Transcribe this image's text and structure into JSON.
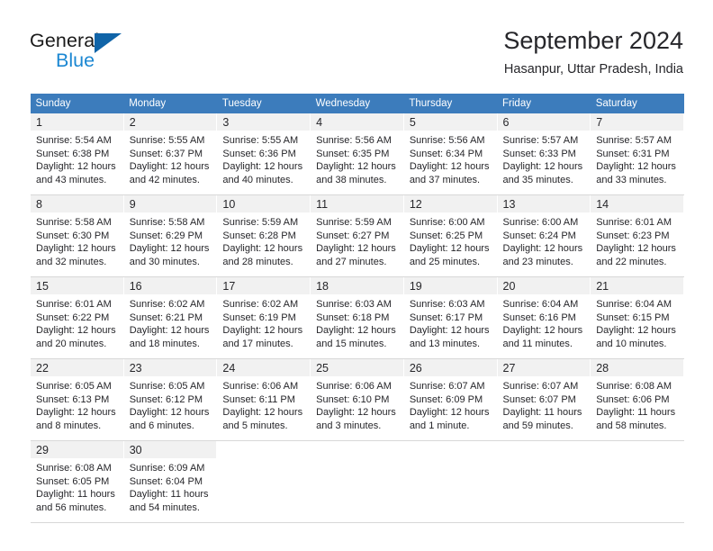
{
  "brand": {
    "word1": "General",
    "word2": "Blue",
    "triangle_color": "#1064a8",
    "blue_color": "#1b87d2"
  },
  "header": {
    "title": "September 2024",
    "subtitle": "Hasanpur, Uttar Pradesh, India"
  },
  "theme": {
    "header_row_bg": "#3c7cbc",
    "header_row_text": "#ffffff",
    "daynum_band_bg": "#f1f1f1",
    "grid_rule": "#d8d8d8",
    "text": "#26262a"
  },
  "weekday_headers": [
    "Sunday",
    "Monday",
    "Tuesday",
    "Wednesday",
    "Thursday",
    "Friday",
    "Saturday"
  ],
  "weeks": [
    [
      {
        "day": "1",
        "sunrise": "Sunrise: 5:54 AM",
        "sunset": "Sunset: 6:38 PM",
        "daylight1": "Daylight: 12 hours",
        "daylight2": "and 43 minutes."
      },
      {
        "day": "2",
        "sunrise": "Sunrise: 5:55 AM",
        "sunset": "Sunset: 6:37 PM",
        "daylight1": "Daylight: 12 hours",
        "daylight2": "and 42 minutes."
      },
      {
        "day": "3",
        "sunrise": "Sunrise: 5:55 AM",
        "sunset": "Sunset: 6:36 PM",
        "daylight1": "Daylight: 12 hours",
        "daylight2": "and 40 minutes."
      },
      {
        "day": "4",
        "sunrise": "Sunrise: 5:56 AM",
        "sunset": "Sunset: 6:35 PM",
        "daylight1": "Daylight: 12 hours",
        "daylight2": "and 38 minutes."
      },
      {
        "day": "5",
        "sunrise": "Sunrise: 5:56 AM",
        "sunset": "Sunset: 6:34 PM",
        "daylight1": "Daylight: 12 hours",
        "daylight2": "and 37 minutes."
      },
      {
        "day": "6",
        "sunrise": "Sunrise: 5:57 AM",
        "sunset": "Sunset: 6:33 PM",
        "daylight1": "Daylight: 12 hours",
        "daylight2": "and 35 minutes."
      },
      {
        "day": "7",
        "sunrise": "Sunrise: 5:57 AM",
        "sunset": "Sunset: 6:31 PM",
        "daylight1": "Daylight: 12 hours",
        "daylight2": "and 33 minutes."
      }
    ],
    [
      {
        "day": "8",
        "sunrise": "Sunrise: 5:58 AM",
        "sunset": "Sunset: 6:30 PM",
        "daylight1": "Daylight: 12 hours",
        "daylight2": "and 32 minutes."
      },
      {
        "day": "9",
        "sunrise": "Sunrise: 5:58 AM",
        "sunset": "Sunset: 6:29 PM",
        "daylight1": "Daylight: 12 hours",
        "daylight2": "and 30 minutes."
      },
      {
        "day": "10",
        "sunrise": "Sunrise: 5:59 AM",
        "sunset": "Sunset: 6:28 PM",
        "daylight1": "Daylight: 12 hours",
        "daylight2": "and 28 minutes."
      },
      {
        "day": "11",
        "sunrise": "Sunrise: 5:59 AM",
        "sunset": "Sunset: 6:27 PM",
        "daylight1": "Daylight: 12 hours",
        "daylight2": "and 27 minutes."
      },
      {
        "day": "12",
        "sunrise": "Sunrise: 6:00 AM",
        "sunset": "Sunset: 6:25 PM",
        "daylight1": "Daylight: 12 hours",
        "daylight2": "and 25 minutes."
      },
      {
        "day": "13",
        "sunrise": "Sunrise: 6:00 AM",
        "sunset": "Sunset: 6:24 PM",
        "daylight1": "Daylight: 12 hours",
        "daylight2": "and 23 minutes."
      },
      {
        "day": "14",
        "sunrise": "Sunrise: 6:01 AM",
        "sunset": "Sunset: 6:23 PM",
        "daylight1": "Daylight: 12 hours",
        "daylight2": "and 22 minutes."
      }
    ],
    [
      {
        "day": "15",
        "sunrise": "Sunrise: 6:01 AM",
        "sunset": "Sunset: 6:22 PM",
        "daylight1": "Daylight: 12 hours",
        "daylight2": "and 20 minutes."
      },
      {
        "day": "16",
        "sunrise": "Sunrise: 6:02 AM",
        "sunset": "Sunset: 6:21 PM",
        "daylight1": "Daylight: 12 hours",
        "daylight2": "and 18 minutes."
      },
      {
        "day": "17",
        "sunrise": "Sunrise: 6:02 AM",
        "sunset": "Sunset: 6:19 PM",
        "daylight1": "Daylight: 12 hours",
        "daylight2": "and 17 minutes."
      },
      {
        "day": "18",
        "sunrise": "Sunrise: 6:03 AM",
        "sunset": "Sunset: 6:18 PM",
        "daylight1": "Daylight: 12 hours",
        "daylight2": "and 15 minutes."
      },
      {
        "day": "19",
        "sunrise": "Sunrise: 6:03 AM",
        "sunset": "Sunset: 6:17 PM",
        "daylight1": "Daylight: 12 hours",
        "daylight2": "and 13 minutes."
      },
      {
        "day": "20",
        "sunrise": "Sunrise: 6:04 AM",
        "sunset": "Sunset: 6:16 PM",
        "daylight1": "Daylight: 12 hours",
        "daylight2": "and 11 minutes."
      },
      {
        "day": "21",
        "sunrise": "Sunrise: 6:04 AM",
        "sunset": "Sunset: 6:15 PM",
        "daylight1": "Daylight: 12 hours",
        "daylight2": "and 10 minutes."
      }
    ],
    [
      {
        "day": "22",
        "sunrise": "Sunrise: 6:05 AM",
        "sunset": "Sunset: 6:13 PM",
        "daylight1": "Daylight: 12 hours",
        "daylight2": "and 8 minutes."
      },
      {
        "day": "23",
        "sunrise": "Sunrise: 6:05 AM",
        "sunset": "Sunset: 6:12 PM",
        "daylight1": "Daylight: 12 hours",
        "daylight2": "and 6 minutes."
      },
      {
        "day": "24",
        "sunrise": "Sunrise: 6:06 AM",
        "sunset": "Sunset: 6:11 PM",
        "daylight1": "Daylight: 12 hours",
        "daylight2": "and 5 minutes."
      },
      {
        "day": "25",
        "sunrise": "Sunrise: 6:06 AM",
        "sunset": "Sunset: 6:10 PM",
        "daylight1": "Daylight: 12 hours",
        "daylight2": "and 3 minutes."
      },
      {
        "day": "26",
        "sunrise": "Sunrise: 6:07 AM",
        "sunset": "Sunset: 6:09 PM",
        "daylight1": "Daylight: 12 hours",
        "daylight2": "and 1 minute."
      },
      {
        "day": "27",
        "sunrise": "Sunrise: 6:07 AM",
        "sunset": "Sunset: 6:07 PM",
        "daylight1": "Daylight: 11 hours",
        "daylight2": "and 59 minutes."
      },
      {
        "day": "28",
        "sunrise": "Sunrise: 6:08 AM",
        "sunset": "Sunset: 6:06 PM",
        "daylight1": "Daylight: 11 hours",
        "daylight2": "and 58 minutes."
      }
    ],
    [
      {
        "day": "29",
        "sunrise": "Sunrise: 6:08 AM",
        "sunset": "Sunset: 6:05 PM",
        "daylight1": "Daylight: 11 hours",
        "daylight2": "and 56 minutes."
      },
      {
        "day": "30",
        "sunrise": "Sunrise: 6:09 AM",
        "sunset": "Sunset: 6:04 PM",
        "daylight1": "Daylight: 11 hours",
        "daylight2": "and 54 minutes."
      },
      {
        "day": "",
        "sunrise": "",
        "sunset": "",
        "daylight1": "",
        "daylight2": ""
      },
      {
        "day": "",
        "sunrise": "",
        "sunset": "",
        "daylight1": "",
        "daylight2": ""
      },
      {
        "day": "",
        "sunrise": "",
        "sunset": "",
        "daylight1": "",
        "daylight2": ""
      },
      {
        "day": "",
        "sunrise": "",
        "sunset": "",
        "daylight1": "",
        "daylight2": ""
      },
      {
        "day": "",
        "sunrise": "",
        "sunset": "",
        "daylight1": "",
        "daylight2": ""
      }
    ]
  ]
}
